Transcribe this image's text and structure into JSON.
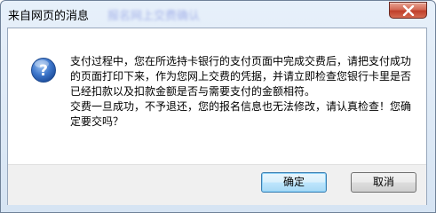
{
  "dialog": {
    "title": "来自网页的消息",
    "title_obscured": "报名网上交费确认",
    "message_paragraph_1": "支付过程中，您在所选持卡银行的支付页面中完成交费后，请把支付成功的页面打印下来，作为您网上交费的凭据，并请立即检查您银行卡里是否已经扣款以及扣款金额是否与需要支付的金额相符。",
    "message_paragraph_2": "交费一旦成功，不予退还，您的报名信息也无法修改，请认真检查！您确定要交吗？",
    "ok_label": "确定",
    "cancel_label": "取消",
    "icon": "question-icon"
  },
  "colors": {
    "frame": "#d6e4f3",
    "close_button": "#c0402a",
    "icon": "#2f63b8",
    "footer": "#f0f0f0"
  }
}
